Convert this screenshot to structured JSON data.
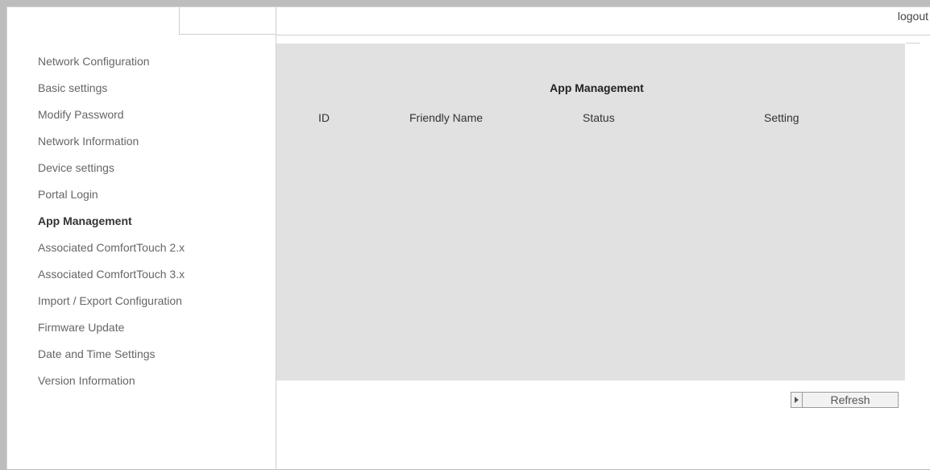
{
  "header": {
    "logout_label": "logout"
  },
  "sidebar": {
    "items": [
      {
        "label": "Network Configuration"
      },
      {
        "label": "Basic settings"
      },
      {
        "label": "Modify Password"
      },
      {
        "label": "Network Information"
      },
      {
        "label": "Device settings"
      },
      {
        "label": "Portal Login"
      },
      {
        "label": "App Management",
        "active": true
      },
      {
        "label": "Associated ComfortTouch 2.x"
      },
      {
        "label": "Associated ComfortTouch 3.x"
      },
      {
        "label": "Import / Export Configuration"
      },
      {
        "label": "Firmware Update"
      },
      {
        "label": "Date and Time Settings"
      },
      {
        "label": "Version Information"
      }
    ]
  },
  "main": {
    "title": "App Management",
    "columns": [
      "ID",
      "Friendly Name",
      "Status",
      "Setting"
    ],
    "refresh_label": "Refresh"
  },
  "colors": {
    "panel_background": "#e1e1e1",
    "page_background": "#ffffff",
    "border": "#cfcfcf"
  }
}
